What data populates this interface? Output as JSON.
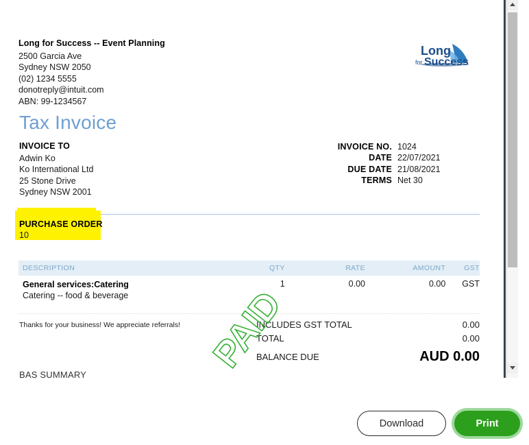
{
  "seller": {
    "name": "Long for Success --  Event Planning",
    "address_lines": [
      "2500 Garcia Ave",
      "Sydney NSW  2050",
      "(02) 1234 5555",
      "donotreply@intuit.com",
      "ABN: 99-1234567"
    ]
  },
  "logo": {
    "line1": "Long",
    "line2_small": "for",
    "line2": "Success",
    "color": "#1b4f8a",
    "accent": "#2e7bbf"
  },
  "title": "Tax Invoice",
  "bill_to": {
    "label": "INVOICE TO",
    "lines": [
      "Adwin Ko",
      "Ko International Ltd",
      "25 Stone Drive",
      "Sydney NSW  2001"
    ]
  },
  "meta": [
    {
      "label": "INVOICE NO.",
      "value": "1024"
    },
    {
      "label": "DATE",
      "value": "22/07/2021"
    },
    {
      "label": "DUE DATE",
      "value": "21/08/2021"
    },
    {
      "label": "TERMS",
      "value": "Net 30"
    }
  ],
  "purchase_order": {
    "label": "PURCHASE ORDER",
    "value": "10",
    "highlight_color": "#fff200"
  },
  "items_table": {
    "headers": [
      "DESCRIPTION",
      "QTY",
      "RATE",
      "AMOUNT",
      "GST"
    ],
    "header_bg": "#e3eef6",
    "header_text_color": "#7fa8c9",
    "rows": [
      {
        "description_main": "General services:Catering",
        "description_sub": "Catering -- food & beverage",
        "qty": "1",
        "rate": "0.00",
        "amount": "0.00",
        "gst": "GST"
      }
    ]
  },
  "thanks_note": "Thanks for your business!  We appreciate referrals!",
  "totals": [
    {
      "label": "INCLUDES GST TOTAL",
      "value": "0.00"
    },
    {
      "label": "TOTAL",
      "value": "0.00"
    }
  ],
  "balance_due": {
    "label": "BALANCE DUE",
    "value": "AUD 0.00"
  },
  "paid_stamp": {
    "text": "PAID",
    "color": "#35b035"
  },
  "bas_summary": {
    "label": "BAS SUMMARY"
  },
  "scrollbar": {
    "up_arrow": "scroll-up-arrow",
    "down_arrow": "scroll-down-arrow"
  },
  "footer": {
    "download_label": "Download",
    "print_label": "Print",
    "print_color": "#2ca01c"
  }
}
